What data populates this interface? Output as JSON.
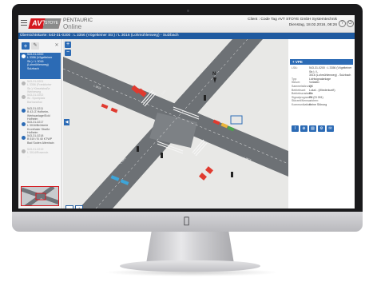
{
  "header": {
    "logo": "AVT",
    "logo_sub": "STOYE",
    "product_line1": "PENTAURIC",
    "product_line2": "Online",
    "user": "Client : Code Tag AVT STOYE GmbH Systemtechnik",
    "date": "Dienstag, 18.02.2016, 08:26",
    "icons": [
      "help-icon",
      "power-icon"
    ]
  },
  "title_bar": {
    "text": "Übersichtskarte: 543-31-0200 : L 3356 (Vögelteiner Str.) / L 3016 (Lohmühlenweg) - Sulzbach"
  },
  "sidebar": {
    "buttons": [
      {
        "name": "add-button",
        "label": "+"
      },
      {
        "name": "tools-button",
        "label": "✎"
      }
    ],
    "close_label": "✕",
    "items": [
      {
        "text": "543-31-0200\nL 3356 (Vögelteiner\nStr.) / L 3016\n(Lohmühlenweg)\nSulzbach",
        "status": "selected",
        "dot_color": "#ffffff"
      },
      {
        "text": "543-31-0201\nL 3356 (Frankfurter\nStr.)/ Kieselstraße\nWerbeweg",
        "status": "faded",
        "dot_color": "#b8b8b8"
      },
      {
        "text": "543-31-0202\nW...Sportplatz\nBarbarathal",
        "status": "faded",
        "dot_color": "#b8b8b8"
      },
      {
        "text": "543-31-0211\nB 43 /Z Hofheim-\nWerksanlage/Eckl\nHofheim",
        "status": "active",
        "dot_color": "#2c6bb5"
      },
      {
        "text": "543-31-0217\nL 3016/Brühlerle\nKronthaler Straße\nHofheim",
        "status": "active",
        "dot_color": "#2c6bb5"
      },
      {
        "text": "543-31-0218\nB 519 / B 40 KTWP\nBad Soden Altenhain",
        "status": "active",
        "dot_color": "#2c6bb5"
      },
      {
        "text": "543-31-0219\nL 3014/Rosenstr.\n...",
        "status": "faded",
        "dot_color": "#b8b8b8"
      }
    ]
  },
  "map": {
    "north_label": "N",
    "zoom_in": "+",
    "zoom_out": "−",
    "road_labels": [
      "L 3016",
      "L 3016",
      "L 3356",
      "L 3356"
    ],
    "tool_buttons": [
      "↔",
      "↕"
    ],
    "side_arrow": "◀"
  },
  "info_panel": {
    "header": "+ VPE",
    "rows": [
      {
        "k": "LSA:",
        "v": "543-31-0200 : L 3356 (Vögelteiner Str.) / L\n3016 (Lohmühlenweg) - Sulzbach"
      },
      {
        "k": "Typ:",
        "v": "Lichtsignalanlage"
      },
      {
        "k": "Steuer:",
        "v": "Vollaktiv"
      },
      {
        "k": "Sammelstörung:",
        "v": "OK"
      },
      {
        "k": "Betriebsart:",
        "v": "Lokal - (Wiederkunft)"
      },
      {
        "k": "Betriebszustand:",
        "v": "Ein"
      },
      {
        "k": "Signalprogramm:",
        "v": "P2 (SI 091)"
      },
      {
        "k": "Störzeit/Kennzeichen:",
        "v": "–"
      },
      {
        "k": "Kommunikation:",
        "v": "Keine Störung"
      }
    ],
    "icons": [
      "I",
      "⊕",
      "▤",
      "⚙",
      "✉"
    ]
  },
  "hardware": {
    "chin_logo": ""
  }
}
